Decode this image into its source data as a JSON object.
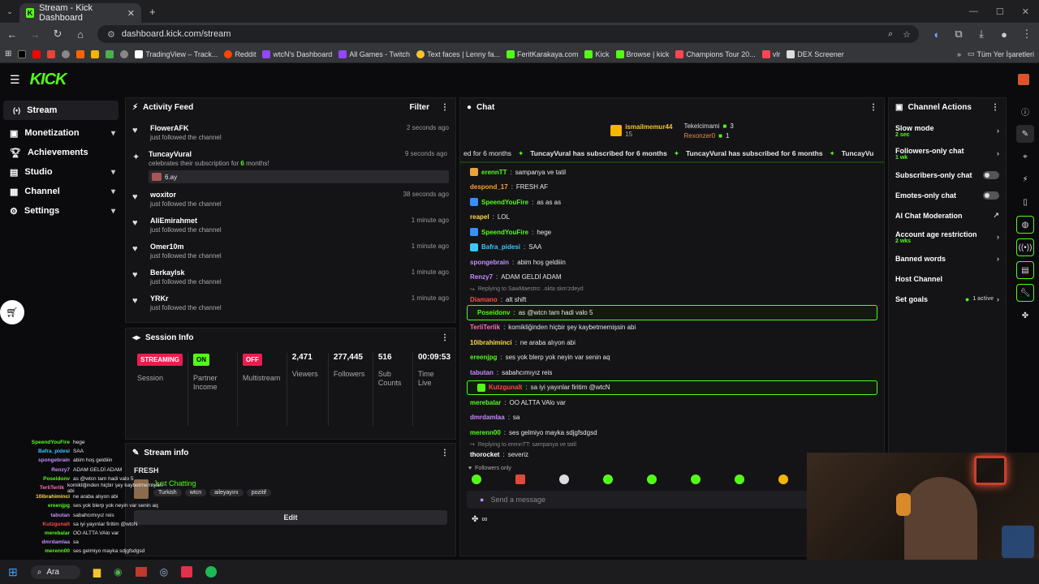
{
  "browser": {
    "tab_title": "Stream - Kick Dashboard",
    "url": "dashboard.kick.com/stream",
    "bookmarks": [
      "TradingView – Track...",
      "Reddit",
      "wtcN's Dashboard",
      "All Games - Twitch",
      "Text faces | Lenny fa...",
      "FeritKarakaya.com",
      "Kick",
      "Browse | kick",
      "Champions Tour 20...",
      "vlr",
      "DEX Screener"
    ],
    "all_bookmarks": "Tüm Yer İşaretleri"
  },
  "app": {
    "logo": "KICK"
  },
  "sidebar": {
    "items": [
      {
        "label": "Stream",
        "icon": "stream-icon"
      },
      {
        "label": "Monetization",
        "icon": "monetization-icon"
      },
      {
        "label": "Achievements",
        "icon": "trophy-icon"
      },
      {
        "label": "Studio",
        "icon": "studio-icon"
      },
      {
        "label": "Channel",
        "icon": "channel-icon"
      },
      {
        "label": "Settings",
        "icon": "gear-icon"
      }
    ]
  },
  "activity": {
    "title": "Activity Feed",
    "filter": "Filter",
    "items": [
      {
        "name": "FlowerAFK",
        "text": "just followed the channel",
        "time": "2 seconds ago"
      },
      {
        "name": "TuncayVural",
        "text": "celebrates their subscription for",
        "highlight": "6",
        "text2": "months!",
        "time": "9 seconds ago",
        "attachment": "6.ay"
      },
      {
        "name": "woxitor",
        "text": "just followed the channel",
        "time": "38 seconds ago"
      },
      {
        "name": "AliEmirahmet",
        "text": "just followed the channel",
        "time": "1 minute ago"
      },
      {
        "name": "Omer10m",
        "text": "just followed the channel",
        "time": "1 minute ago"
      },
      {
        "name": "Berkaylsk",
        "text": "just followed the channel",
        "time": "1 minute ago"
      },
      {
        "name": "YRKr",
        "text": "just followed the channel",
        "time": "1 minute ago"
      }
    ]
  },
  "session": {
    "title": "Session Info",
    "cols": [
      {
        "pill": "STREAMING",
        "label": "Session"
      },
      {
        "pill": "ON",
        "label": "Partner Income"
      },
      {
        "pill": "OFF",
        "label": "Multistream"
      },
      {
        "num": "2,471",
        "label": "Viewers"
      },
      {
        "num": "277,445",
        "label": "Followers"
      },
      {
        "num": "516",
        "label": "Sub Counts"
      },
      {
        "num": "00:09:53",
        "label": "Time Live"
      }
    ]
  },
  "streaminfo": {
    "title": "Stream info",
    "stream_title": "FRESH",
    "category": "Just Chatting",
    "tags": [
      "Turkish",
      "wtcn",
      "aileyayını",
      "pozitif"
    ],
    "edit": "Edit"
  },
  "chat": {
    "title": "Chat",
    "top": [
      {
        "name": "ismailmemur44",
        "count": "15"
      },
      {
        "name": "Tekelcimami",
        "count": "3"
      },
      {
        "name": "Rexonzer0",
        "count": "1"
      }
    ],
    "ticker": [
      "ed for 6 months",
      "TuncayVural has subscribed for 6 months",
      "TuncayVural has subscribed for 6 months",
      "TuncayVu"
    ],
    "messages": [
      {
        "user": "erennTT",
        "color": "#53fc18",
        "text": "sampanya ve tatil"
      },
      {
        "user": "despond_17",
        "color": "#ff9f3a",
        "text": "FRESH AF"
      },
      {
        "user": "SpeendYouFire",
        "color": "#53fc18",
        "text": "as as as"
      },
      {
        "user": "reapel",
        "color": "#ffd84a",
        "text": "LOL"
      },
      {
        "user": "SpeendYouFire",
        "color": "#53fc18",
        "text": "hege"
      },
      {
        "user": "Bafra_pidesi",
        "color": "#38c8ff",
        "text": "SAA"
      },
      {
        "user": "spongebrain",
        "color": "#c68cff",
        "text": "abim hoş geldiiin"
      },
      {
        "user": "Renzy7",
        "color": "#c68cff",
        "text": "ADAM GELDİ ADAM"
      },
      {
        "reply": "Replying to SawMaestro: .okta skm'zdeyd"
      },
      {
        "user": "Diamano",
        "color": "#ff4a4a",
        "text": "alt shift"
      },
      {
        "user": "Poseidonv",
        "color": "#53fc18",
        "text": "as @wtcn tam hadi valo 5",
        "hl": true
      },
      {
        "user": "TerliTerlik",
        "color": "#ff6fb0",
        "text": "komikliğinden hiçbir şey kaybetmemişsin abi"
      },
      {
        "user": "10ibrahiminci",
        "color": "#ffd84a",
        "text": "ne araba alıyon abi"
      },
      {
        "user": "ereenjpg",
        "color": "#53fc18",
        "text": "ses yok blerp yok neyin var senin aq"
      },
      {
        "user": "tabutan",
        "color": "#c68cff",
        "text": "sabahcımıyız reis"
      },
      {
        "user": "Kutzgunalt",
        "color": "#ff4a4a",
        "text": "sa iyi yayınlar firitim @wtcN",
        "hl": true
      },
      {
        "user": "merebalar",
        "color": "#53fc18",
        "text": "OO ALTTA VAlo var"
      },
      {
        "user": "dmrdamlaa",
        "color": "#c68cff",
        "text": "sa"
      },
      {
        "user": "merenn00",
        "color": "#53fc18",
        "text": "ses gelmiyo mayka sdjgfsdgsd"
      },
      {
        "reply": "Replying to erennTT: sampanya ve tatil"
      },
      {
        "user": "thorocket",
        "color": "#ffffff",
        "text": "severiz"
      }
    ],
    "followers_only": "Followers only",
    "placeholder": "Send a message"
  },
  "actions": {
    "title": "Channel Actions",
    "items": [
      {
        "label": "Slow mode",
        "meta": "2 sec",
        "kind": "chev"
      },
      {
        "label": "Followers-only chat",
        "meta": "1 wk",
        "kind": "chev"
      },
      {
        "label": "Subscribers-only chat",
        "kind": "toggle"
      },
      {
        "label": "Emotes-only chat",
        "kind": "toggle"
      },
      {
        "label": "AI Chat Moderation",
        "kind": "ext"
      },
      {
        "label": "Account age restriction",
        "meta": "2 wks",
        "kind": "chev"
      },
      {
        "label": "Banned words",
        "kind": "chev"
      },
      {
        "label": "Host Channel",
        "kind": "none"
      },
      {
        "label": "Set goals",
        "meta": "1 active",
        "kind": "chev"
      }
    ]
  },
  "overlay": [
    {
      "u": "SpeendYouFire",
      "t": "hege"
    },
    {
      "u": "Bafra_pidesi",
      "t": "SAA"
    },
    {
      "u": "spongebrain",
      "t": "abim hoş geldiiin"
    },
    {
      "u": "Renzy7",
      "t": "ADAM GELDİ ADAM"
    },
    {
      "u": "Poseidonv",
      "t": "as @wtcn tam hadi valo 5"
    },
    {
      "u": "TerliTerlik",
      "t": "komikliğinden hiçbir şey kaybetmemişsin abi"
    },
    {
      "u": "10ibrahiminci",
      "t": "ne araba alıyon abi"
    },
    {
      "u": "ereenjpg",
      "t": "ses yok blerp yok neyin var senin aq"
    },
    {
      "u": "tabutan",
      "t": "sabahcımıyız reis"
    },
    {
      "u": "Kutzgunalt",
      "t": "sa iyi yayınlar firitim @wtcN"
    },
    {
      "u": "merebalar",
      "t": "OO ALTTA VAlo var"
    },
    {
      "u": "dmrdamlaa",
      "t": "sa"
    },
    {
      "u": "merenn00",
      "t": "ses gelmiyo mayka sdjgfsdgsd"
    }
  ],
  "taskbar": {
    "search": "Ara"
  },
  "colors": {
    "accent": "#53fc18",
    "danger": "#e91e4f"
  }
}
